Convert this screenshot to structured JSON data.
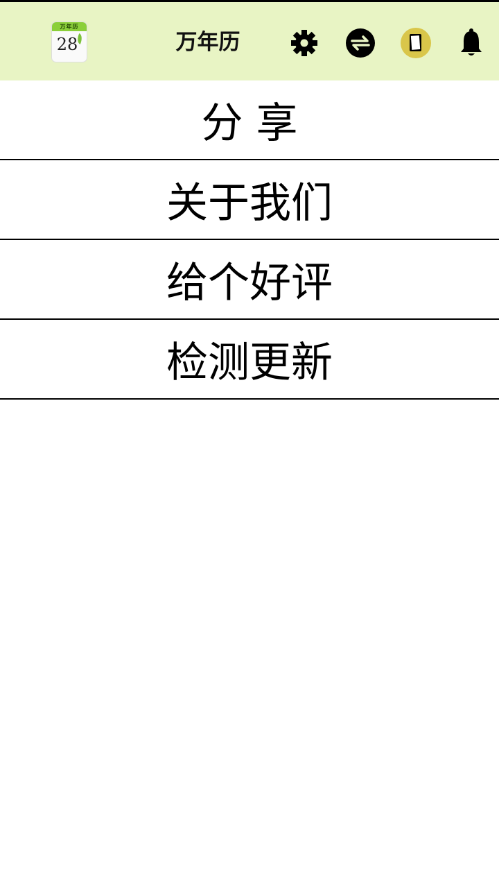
{
  "header": {
    "title": "万年历",
    "app_icon": {
      "name": "calendar-app-icon",
      "band_text": "万年历",
      "day": "28"
    },
    "icons": [
      "gear-icon",
      "sync-icon",
      "notebook-icon",
      "bell-icon"
    ]
  },
  "menu": {
    "items": [
      {
        "label": "分 享"
      },
      {
        "label": "关于我们"
      },
      {
        "label": "给个好评"
      },
      {
        "label": "检测更新"
      }
    ]
  },
  "colors": {
    "header_bg": "#e8f4c4",
    "icon_band": "#8bcf3a",
    "notebook_circle": "#d9c64a",
    "text": "#000000"
  }
}
